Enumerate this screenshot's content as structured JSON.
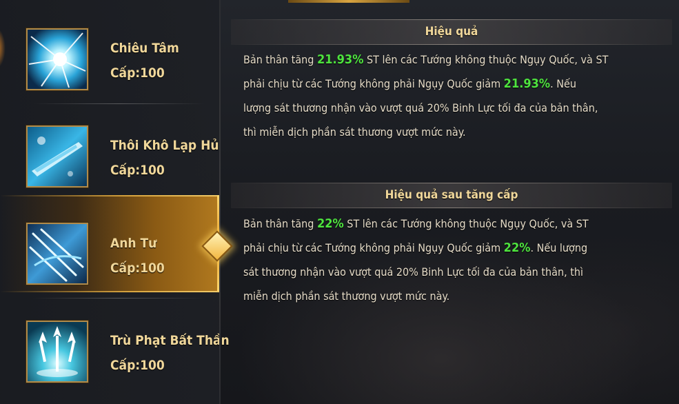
{
  "colors": {
    "highlight": "#4ee33e",
    "gold_text": "#f0d79a",
    "body_text": "#e6dcc8",
    "active_gold": "#e7a22c"
  },
  "skills": [
    {
      "name": "Chiêu Tâm",
      "level": "Cấp:100",
      "icon": "light-burst-icon",
      "active": false
    },
    {
      "name": "Thôi Khô Lạp Hủ",
      "level": "Cấp:100",
      "icon": "ice-blade-icon",
      "active": false
    },
    {
      "name": "Anh Tư",
      "level": "Cấp:100",
      "icon": "wind-spears-icon",
      "active": true
    },
    {
      "name": "Trù Phạt Bất Thần",
      "level": "Cấp:100",
      "icon": "trident-icon",
      "active": false
    }
  ],
  "effect": {
    "title": "Hiệu quả",
    "lines": [
      [
        {
          "t": "Bản thân tăng "
        },
        {
          "t": "21.93%",
          "hl": true
        },
        {
          "t": " ST lên các Tướng không thuộc Ngụy Quốc, và ST"
        }
      ],
      [
        {
          "t": "phải chịu từ các Tướng không phải Ngụy Quốc giảm "
        },
        {
          "t": "21.93%",
          "hl": true
        },
        {
          "t": ". Nếu"
        }
      ],
      [
        {
          "t": "lượng sát thương nhận vào vượt quá 20% Binh Lực tối đa của bản thân,"
        }
      ],
      [
        {
          "t": "thì miễn dịch phần sát thương vượt mức này."
        }
      ]
    ]
  },
  "effect_next": {
    "title": "Hiệu quả sau tăng cấp",
    "lines": [
      [
        {
          "t": "Bản thân tăng "
        },
        {
          "t": "22%",
          "hl": true
        },
        {
          "t": " ST lên các Tướng không thuộc Ngụy Quốc, và ST"
        }
      ],
      [
        {
          "t": "phải chịu từ các Tướng không phải Ngụy Quốc giảm "
        },
        {
          "t": "22%",
          "hl": true
        },
        {
          "t": ". Nếu lượng"
        }
      ],
      [
        {
          "t": "sát thương nhận vào vượt quá 20% Binh Lực tối đa của bản thân, thì"
        }
      ],
      [
        {
          "t": "miễn dịch phần sát thương vượt mức này."
        }
      ]
    ]
  }
}
